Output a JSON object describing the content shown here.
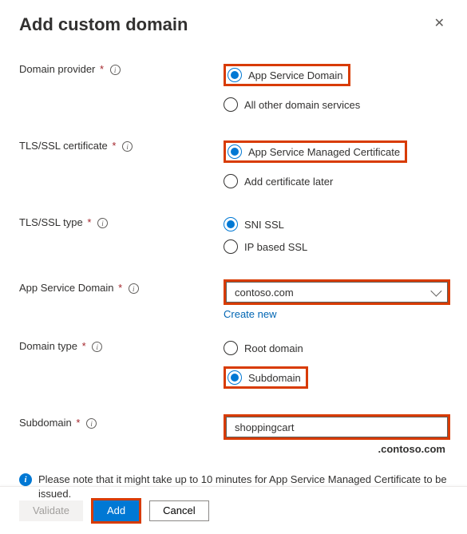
{
  "header": {
    "title": "Add custom domain"
  },
  "fields": {
    "domainProvider": {
      "label": "Domain provider",
      "options": [
        "App Service Domain",
        "All other domain services"
      ],
      "selected": 0
    },
    "tlsCertificate": {
      "label": "TLS/SSL certificate",
      "options": [
        "App Service Managed Certificate",
        "Add certificate later"
      ],
      "selected": 0
    },
    "tlsType": {
      "label": "TLS/SSL type",
      "options": [
        "SNI SSL",
        "IP based SSL"
      ],
      "selected": 0
    },
    "appServiceDomain": {
      "label": "App Service Domain",
      "value": "contoso.com",
      "createNew": "Create new"
    },
    "domainType": {
      "label": "Domain type",
      "options": [
        "Root domain",
        "Subdomain"
      ],
      "selected": 1
    },
    "subdomain": {
      "label": "Subdomain",
      "value": "shoppingcart",
      "suffix": ".contoso.com"
    }
  },
  "note": "Please note that it might take up to 10 minutes for App Service Managed Certificate to be issued.",
  "footer": {
    "validate": "Validate",
    "add": "Add",
    "cancel": "Cancel"
  }
}
